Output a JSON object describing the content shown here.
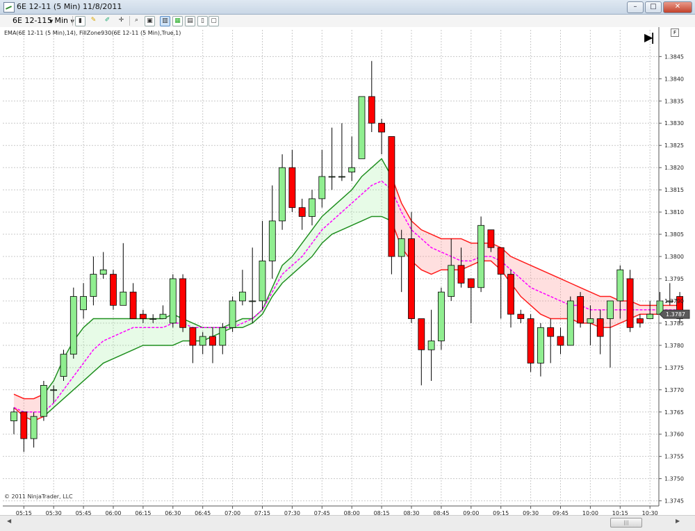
{
  "window": {
    "title": "6E 12-11 (5 Min)  11/8/2011",
    "minimize": "–",
    "maximize": "□",
    "close": "✕"
  },
  "toolbar": {
    "instrument": "6E 12-11",
    "interval": "5 Min",
    "icons": [
      "bar-type-icon",
      "drawing-pencil-icon",
      "marker-icon",
      "crosshair-icon",
      "zoom-icon",
      "chart-style-icon",
      "indicators-icon",
      "strategies-icon",
      "properties-icon",
      "data-box-icon"
    ]
  },
  "chart": {
    "indicator_label": "EMA(6E 12-11 (5 Min),14), FillZone930(6E 12-11 (5 Min),True,1)",
    "copyright": "© 2011 NinjaTrader, LLC",
    "f_button": "F",
    "current_price": "1.3787",
    "colors": {
      "up": "#90ee90",
      "down": "#ff0000",
      "green_band": "#1f8f1f",
      "red_band": "#ff1a1a",
      "ema": "#ff00ff",
      "green_fill": "rgba(144,238,144,0.22)",
      "red_fill": "rgba(255,140,140,0.28)"
    }
  },
  "chart_data": {
    "type": "candlestick",
    "y_ticks": [
      "1.3745",
      "1.3750",
      "1.3755",
      "1.3760",
      "1.3765",
      "1.3770",
      "1.3775",
      "1.3780",
      "1.3785",
      "1.3790",
      "1.3795",
      "1.3800",
      "1.3805",
      "1.3810",
      "1.3815",
      "1.3820",
      "1.3825",
      "1.3830",
      "1.3835",
      "1.3840",
      "1.3845"
    ],
    "x_ticks": [
      "05:15",
      "05:30",
      "05:45",
      "06:00",
      "06:15",
      "06:30",
      "06:45",
      "07:00",
      "07:15",
      "07:30",
      "07:45",
      "08:00",
      "08:15",
      "08:30",
      "08:45",
      "09:00",
      "09:15",
      "09:30",
      "09:45",
      "10:00",
      "10:15",
      "10:30"
    ],
    "ylim": [
      1.3744,
      1.3851
    ],
    "grid": true,
    "candles": [
      [
        1.3763,
        1.3765,
        1.3766,
        1.376
      ],
      [
        1.3765,
        1.3759,
        1.3765,
        1.3756
      ],
      [
        1.3759,
        1.3764,
        1.3765,
        1.3757
      ],
      [
        1.3764,
        1.3771,
        1.3772,
        1.3763
      ],
      [
        1.377,
        1.377,
        1.3771,
        1.3767
      ],
      [
        1.3773,
        1.3778,
        1.3779,
        1.3772
      ],
      [
        1.3778,
        1.3791,
        1.3793,
        1.3777
      ],
      [
        1.3788,
        1.3791,
        1.3794,
        1.3786
      ],
      [
        1.3791,
        1.3796,
        1.38,
        1.3789
      ],
      [
        1.3796,
        1.3797,
        1.3801,
        1.3795
      ],
      [
        1.3796,
        1.3789,
        1.3797,
        1.3788
      ],
      [
        1.3789,
        1.3792,
        1.3803,
        1.379
      ],
      [
        1.3792,
        1.3786,
        1.3794,
        1.3786
      ],
      [
        1.3787,
        1.3786,
        1.3788,
        1.3785
      ],
      [
        1.3786,
        1.3786,
        1.3787,
        1.3785
      ],
      [
        1.3786,
        1.3787,
        1.3789,
        1.3786
      ],
      [
        1.3785,
        1.3795,
        1.3796,
        1.3784
      ],
      [
        1.3795,
        1.3784,
        1.3796,
        1.3783
      ],
      [
        1.3784,
        1.378,
        1.3784,
        1.3776
      ],
      [
        1.378,
        1.3782,
        1.3783,
        1.3778
      ],
      [
        1.3782,
        1.378,
        1.3784,
        1.3776
      ],
      [
        1.378,
        1.3784,
        1.3785,
        1.3778
      ],
      [
        1.3784,
        1.379,
        1.3791,
        1.3783
      ],
      [
        1.379,
        1.3792,
        1.3797,
        1.3789
      ],
      [
        1.379,
        1.379,
        1.3802,
        1.3785
      ],
      [
        1.379,
        1.3799,
        1.3808,
        1.3788
      ],
      [
        1.3799,
        1.3808,
        1.3816,
        1.3795
      ],
      [
        1.3808,
        1.382,
        1.3823,
        1.3806
      ],
      [
        1.382,
        1.3811,
        1.3824,
        1.381
      ],
      [
        1.3811,
        1.3809,
        1.3813,
        1.3806
      ],
      [
        1.3809,
        1.3813,
        1.3815,
        1.3807
      ],
      [
        1.3813,
        1.3818,
        1.3824,
        1.3811
      ],
      [
        1.3818,
        1.3818,
        1.3829,
        1.3815
      ],
      [
        1.3818,
        1.3818,
        1.383,
        1.3817
      ],
      [
        1.3819,
        1.382,
        1.3827,
        1.3817
      ],
      [
        1.3822,
        1.3836,
        1.383,
        1.3822
      ],
      [
        1.3836,
        1.383,
        1.3844,
        1.3828
      ],
      [
        1.383,
        1.3828,
        1.3831,
        1.3823
      ],
      [
        1.3827,
        1.38,
        1.3827,
        1.3796
      ],
      [
        1.38,
        1.3804,
        1.3806,
        1.3792
      ],
      [
        1.3804,
        1.3786,
        1.381,
        1.3785
      ],
      [
        1.3786,
        1.3779,
        1.3786,
        1.3771
      ],
      [
        1.3779,
        1.3781,
        1.3788,
        1.3772
      ],
      [
        1.3781,
        1.3792,
        1.3793,
        1.3779
      ],
      [
        1.3791,
        1.3798,
        1.3804,
        1.379
      ],
      [
        1.3798,
        1.3794,
        1.3802,
        1.3793
      ],
      [
        1.3795,
        1.3793,
        1.3794,
        1.3785
      ],
      [
        1.3793,
        1.3807,
        1.3809,
        1.3792
      ],
      [
        1.3806,
        1.3802,
        1.3806,
        1.3801
      ],
      [
        1.3802,
        1.3796,
        1.3801,
        1.3786
      ],
      [
        1.3796,
        1.3787,
        1.3797,
        1.3784
      ],
      [
        1.3787,
        1.3786,
        1.3788,
        1.3785
      ],
      [
        1.3786,
        1.3776,
        1.3787,
        1.3774
      ],
      [
        1.3776,
        1.3784,
        1.3785,
        1.3773
      ],
      [
        1.3784,
        1.3782,
        1.3786,
        1.3776
      ],
      [
        1.3782,
        1.378,
        1.3784,
        1.3778
      ],
      [
        1.378,
        1.379,
        1.3791,
        1.378
      ],
      [
        1.3791,
        1.3785,
        1.3792,
        1.3784
      ],
      [
        1.3785,
        1.3786,
        1.3789,
        1.378
      ],
      [
        1.3786,
        1.3782,
        1.3788,
        1.3778
      ],
      [
        1.3786,
        1.379,
        1.379,
        1.3775
      ],
      [
        1.379,
        1.3797,
        1.3798,
        1.3786
      ],
      [
        1.3795,
        1.3784,
        1.3797,
        1.3783
      ],
      [
        1.3786,
        1.3785,
        1.3787,
        1.3784
      ],
      [
        1.3786,
        1.3787,
        1.379,
        1.3786
      ],
      [
        1.3787,
        1.379,
        1.3792,
        1.3787
      ],
      [
        1.379,
        1.379,
        1.3794,
        1.3789
      ],
      [
        1.3791,
        1.3786,
        1.3792,
        1.3785
      ]
    ],
    "band_upper": [
      1.3769,
      1.3768,
      1.3768,
      1.3769,
      1.3772,
      1.3777,
      1.3781,
      1.3784,
      1.3786,
      1.3786,
      1.3786,
      1.3786,
      1.3786,
      1.3786,
      1.3786,
      1.3786,
      1.3787,
      1.3786,
      1.3785,
      1.3784,
      1.3784,
      1.3784,
      1.3785,
      1.3786,
      1.3786,
      1.3788,
      1.3793,
      1.3798,
      1.38,
      1.3803,
      1.3806,
      1.3809,
      1.3811,
      1.3813,
      1.3815,
      1.3818,
      1.382,
      1.3822,
      1.3818,
      1.3812,
      1.3808,
      1.3806,
      1.3805,
      1.3804,
      1.3804,
      1.3804,
      1.3803,
      1.3803,
      1.3803,
      1.3802,
      1.38,
      1.3799,
      1.3798,
      1.3797,
      1.3796,
      1.3795,
      1.3794,
      1.3793,
      1.3792,
      1.3791,
      1.3791,
      1.379,
      1.379,
      1.3789,
      1.3789,
      1.3789,
      1.3789,
      1.3789
    ],
    "band_lower": [
      1.3766,
      1.3764,
      1.3763,
      1.3764,
      1.3766,
      1.3768,
      1.377,
      1.3772,
      1.3774,
      1.3776,
      1.3777,
      1.3778,
      1.3779,
      1.378,
      1.378,
      1.378,
      1.378,
      1.3781,
      1.3781,
      1.3781,
      1.3782,
      1.3783,
      1.3784,
      1.3784,
      1.3785,
      1.3787,
      1.3791,
      1.3794,
      1.3796,
      1.3798,
      1.38,
      1.3803,
      1.3805,
      1.3806,
      1.3807,
      1.3808,
      1.3809,
      1.3809,
      1.3808,
      1.3802,
      1.3799,
      1.3797,
      1.3796,
      1.3797,
      1.3797,
      1.3797,
      1.3798,
      1.3799,
      1.3799,
      1.3797,
      1.3794,
      1.3791,
      1.3789,
      1.3787,
      1.3786,
      1.3786,
      1.3786,
      1.3785,
      1.3785,
      1.3784,
      1.3784,
      1.3785,
      1.3786,
      1.3787,
      1.3787,
      1.3787,
      1.3787,
      1.3787
    ],
    "ema": [
      1.3766,
      1.3765,
      1.3765,
      1.3765,
      1.3767,
      1.377,
      1.3773,
      1.3776,
      1.3779,
      1.3781,
      1.3782,
      1.3783,
      1.3784,
      1.3784,
      1.3784,
      1.3784,
      1.3785,
      1.3785,
      1.3784,
      1.3784,
      1.3784,
      1.3784,
      1.3784,
      1.3785,
      1.3786,
      1.3788,
      1.3792,
      1.3796,
      1.3798,
      1.38,
      1.3803,
      1.3806,
      1.3808,
      1.381,
      1.3812,
      1.3814,
      1.3816,
      1.3817,
      1.3815,
      1.381,
      1.3806,
      1.3804,
      1.3802,
      1.3801,
      1.38,
      1.3799,
      1.3799,
      1.38,
      1.38,
      1.3799,
      1.3797,
      1.3795,
      1.3793,
      1.3792,
      1.3791,
      1.379,
      1.3789,
      1.3789,
      1.3788,
      1.3788,
      1.3788,
      1.3788,
      1.3788,
      1.3788,
      1.3788,
      1.3788,
      1.3788,
      1.3788
    ]
  }
}
